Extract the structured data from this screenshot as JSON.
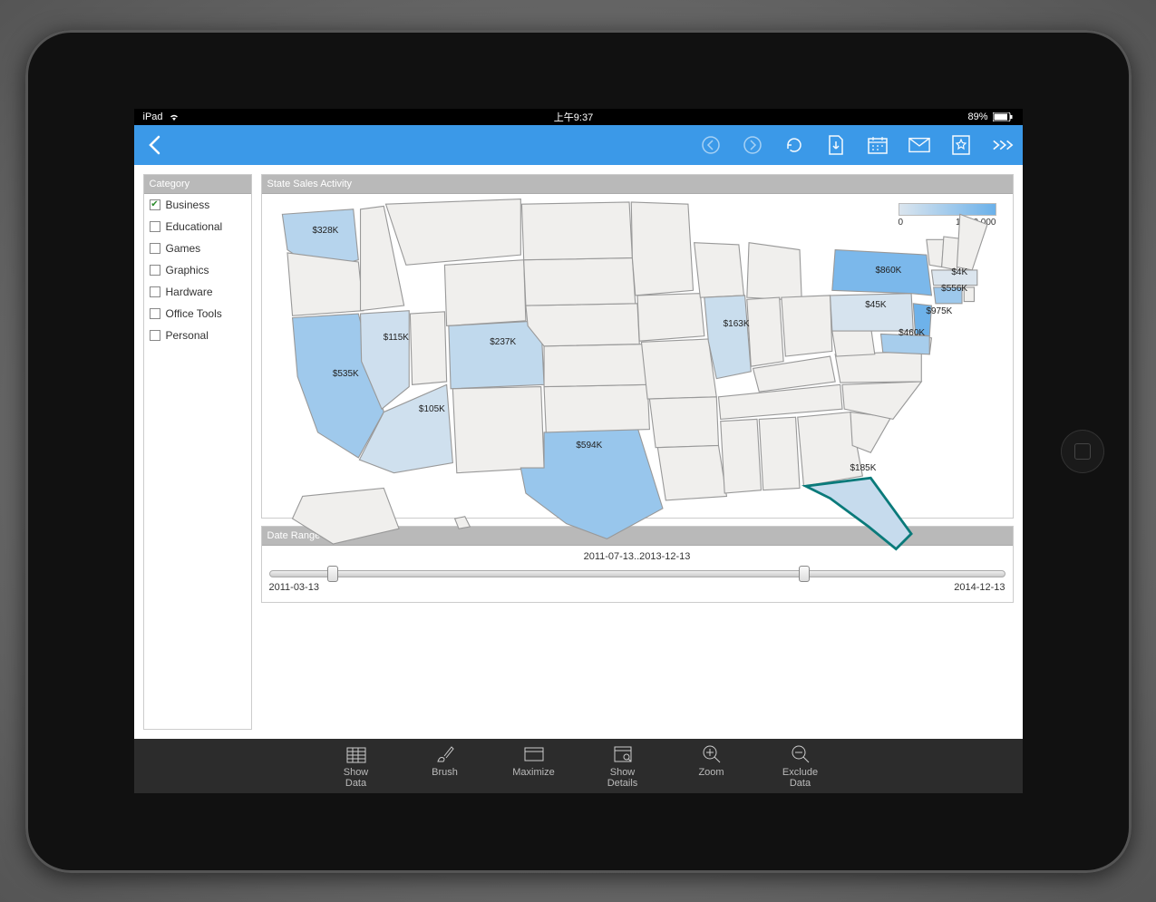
{
  "statusbar": {
    "device": "iPad",
    "time": "上午9:37",
    "battery": "89%"
  },
  "toolbar_icons": [
    "prev",
    "next",
    "refresh",
    "export",
    "calendar",
    "mail",
    "favorite",
    "more"
  ],
  "sidebar": {
    "title": "Category",
    "items": [
      {
        "label": "Business",
        "checked": true
      },
      {
        "label": "Educational",
        "checked": false
      },
      {
        "label": "Games",
        "checked": false
      },
      {
        "label": "Graphics",
        "checked": false
      },
      {
        "label": "Hardware",
        "checked": false
      },
      {
        "label": "Office Tools",
        "checked": false
      },
      {
        "label": "Personal",
        "checked": false
      }
    ]
  },
  "map_panel": {
    "title": "State Sales Activity",
    "legend": {
      "min": "0",
      "max": "1,000,000",
      "range": [
        0,
        1000000
      ]
    }
  },
  "date_panel": {
    "title": "Date Range Selecter",
    "range_text": "2011-07-13..2013-12-13",
    "min": "2011-03-13",
    "max": "2014-12-13",
    "handles_pct": [
      8,
      72
    ]
  },
  "bottom_toolbar": [
    {
      "key": "show-data",
      "label": "Show Data"
    },
    {
      "key": "brush",
      "label": "Brush"
    },
    {
      "key": "maximize",
      "label": "Maximize"
    },
    {
      "key": "show-details",
      "label": "Show Details"
    },
    {
      "key": "zoom",
      "label": "Zoom"
    },
    {
      "key": "exclude-data",
      "label": "Exclude Data"
    }
  ],
  "chart_data": {
    "type": "heatmap",
    "title": "State Sales Activity",
    "unit": "USD",
    "value_range": [
      0,
      1000000
    ],
    "legend_labels": [
      "0",
      "1,000,000"
    ],
    "states": [
      {
        "code": "WA",
        "name": "Washington",
        "value": 328000,
        "label": "$328K"
      },
      {
        "code": "CA",
        "name": "California",
        "value": 535000,
        "label": "$535K"
      },
      {
        "code": "NV",
        "name": "Nevada",
        "value": 115000,
        "label": "$115K"
      },
      {
        "code": "AZ",
        "name": "Arizona",
        "value": 105000,
        "label": "$105K"
      },
      {
        "code": "CO",
        "name": "Colorado",
        "value": 237000,
        "label": "$237K"
      },
      {
        "code": "TX",
        "name": "Texas",
        "value": 594000,
        "label": "$594K"
      },
      {
        "code": "IL",
        "name": "Illinois",
        "value": 163000,
        "label": "$163K"
      },
      {
        "code": "FL",
        "name": "Florida",
        "value": 185000,
        "label": "$185K",
        "selected": true
      },
      {
        "code": "NY",
        "name": "New York",
        "value": 860000,
        "label": "$860K"
      },
      {
        "code": "PA",
        "name": "Pennsylvania",
        "value": 45000,
        "label": "$45K"
      },
      {
        "code": "CT",
        "name": "Connecticut",
        "value": 556000,
        "label": "$556K"
      },
      {
        "code": "MA",
        "name": "Massachusetts",
        "value": 4000,
        "label": "$4K"
      },
      {
        "code": "NJ",
        "name": "New Jersey",
        "value": 975000,
        "label": "$975K"
      },
      {
        "code": "MD",
        "name": "Maryland",
        "value": 460000,
        "label": "$460K"
      }
    ]
  }
}
